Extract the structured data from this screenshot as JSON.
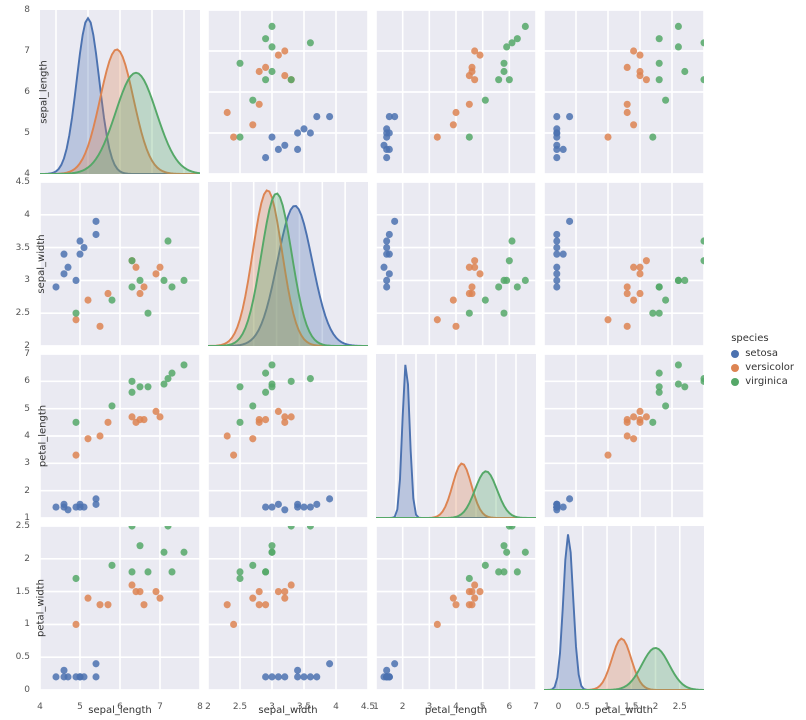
{
  "legend": {
    "title": "species",
    "items": [
      {
        "name": "setosa",
        "color": "#4c72b0"
      },
      {
        "name": "versicolor",
        "color": "#dd8452"
      },
      {
        "name": "virginica",
        "color": "#55a868"
      }
    ]
  },
  "variables": [
    "sepal_length",
    "sepal_width",
    "petal_length",
    "petal_width"
  ],
  "chart_data": {
    "type": "pairplot",
    "note": "4x4 seaborn-style pairplot of iris dataset; diagonals are KDE density plots per species; off-diagonals are scatter of row-var (y) vs col-var (x) colored by species. Values below are representative iris observations (10 per species) read from the scatter panels.",
    "species_colors": {
      "setosa": "#4c72b0",
      "versicolor": "#dd8452",
      "virginica": "#55a868"
    },
    "data": {
      "setosa": {
        "sepal_length": [
          5.1,
          4.9,
          4.7,
          4.6,
          5.0,
          5.4,
          4.6,
          5.0,
          4.4,
          5.4
        ],
        "sepal_width": [
          3.5,
          3.0,
          3.2,
          3.1,
          3.6,
          3.9,
          3.4,
          3.4,
          2.9,
          3.7
        ],
        "petal_length": [
          1.4,
          1.4,
          1.3,
          1.5,
          1.4,
          1.7,
          1.4,
          1.5,
          1.4,
          1.5
        ],
        "petal_width": [
          0.2,
          0.2,
          0.2,
          0.2,
          0.2,
          0.4,
          0.3,
          0.2,
          0.2,
          0.2
        ]
      },
      "versicolor": {
        "sepal_length": [
          7.0,
          6.4,
          6.9,
          5.5,
          6.5,
          5.7,
          6.3,
          4.9,
          6.6,
          5.2
        ],
        "sepal_width": [
          3.2,
          3.2,
          3.1,
          2.3,
          2.8,
          2.8,
          3.3,
          2.4,
          2.9,
          2.7
        ],
        "petal_length": [
          4.7,
          4.5,
          4.9,
          4.0,
          4.6,
          4.5,
          4.7,
          3.3,
          4.6,
          3.9
        ],
        "petal_width": [
          1.4,
          1.5,
          1.5,
          1.3,
          1.5,
          1.3,
          1.6,
          1.0,
          1.3,
          1.4
        ]
      },
      "virginica": {
        "sepal_length": [
          6.3,
          5.8,
          7.1,
          6.3,
          6.5,
          7.6,
          4.9,
          7.3,
          6.7,
          7.2
        ],
        "sepal_width": [
          3.3,
          2.7,
          3.0,
          2.9,
          3.0,
          3.0,
          2.5,
          2.9,
          2.5,
          3.6
        ],
        "petal_length": [
          6.0,
          5.1,
          5.9,
          5.6,
          5.8,
          6.6,
          4.5,
          6.3,
          5.8,
          6.1
        ],
        "petal_width": [
          2.5,
          1.9,
          2.1,
          1.8,
          2.2,
          2.1,
          1.7,
          1.8,
          1.8,
          2.5
        ]
      }
    },
    "axes": {
      "sepal_length": {
        "min": 4,
        "max": 8,
        "ticks": [
          4,
          5,
          6,
          7,
          8
        ]
      },
      "sepal_width": {
        "min": 2,
        "max": 4.5,
        "ticks": [
          2.0,
          2.5,
          3.0,
          3.5,
          4.0,
          4.5
        ]
      },
      "petal_length": {
        "min": 1,
        "max": 7,
        "ticks": [
          1,
          2,
          3,
          4,
          5,
          6,
          7
        ]
      },
      "petal_width": {
        "min": 0,
        "max": 2.5,
        "ticks": [
          0.0,
          0.5,
          1.0,
          1.5,
          2.0,
          2.5
        ]
      }
    },
    "kde_axes": {
      "sepal_length": {
        "min": 3.5,
        "max": 8.5
      },
      "sepal_width": {
        "min": 1.5,
        "max": 5.0
      },
      "petal_length": {
        "min": 0,
        "max": 8
      },
      "petal_width": {
        "min": -0.3,
        "max": 3
      }
    },
    "kde": {
      "sepal_length": {
        "setosa": {
          "mode_x": 5.0,
          "peak": 1.0,
          "sigma": 0.35
        },
        "versicolor": {
          "mode_x": 5.9,
          "peak": 0.8,
          "sigma": 0.52
        },
        "virginica": {
          "mode_x": 6.5,
          "peak": 0.65,
          "sigma": 0.64
        }
      },
      "sepal_width": {
        "setosa": {
          "mode_x": 3.4,
          "peak": 0.9,
          "sigma": 0.38
        },
        "versicolor": {
          "mode_x": 2.8,
          "peak": 1.0,
          "sigma": 0.32
        },
        "virginica": {
          "mode_x": 3.0,
          "peak": 0.98,
          "sigma": 0.33
        }
      },
      "petal_length": {
        "setosa": {
          "mode_x": 1.5,
          "peak": 1.0,
          "sigma": 0.18
        },
        "versicolor": {
          "mode_x": 4.3,
          "peak": 0.35,
          "sigma": 0.47
        },
        "virginica": {
          "mode_x": 5.5,
          "peak": 0.3,
          "sigma": 0.55
        }
      },
      "petal_width": {
        "setosa": {
          "mode_x": 0.2,
          "peak": 1.0,
          "sigma": 0.1
        },
        "versicolor": {
          "mode_x": 1.3,
          "peak": 0.33,
          "sigma": 0.2
        },
        "virginica": {
          "mode_x": 2.0,
          "peak": 0.27,
          "sigma": 0.28
        }
      }
    }
  }
}
